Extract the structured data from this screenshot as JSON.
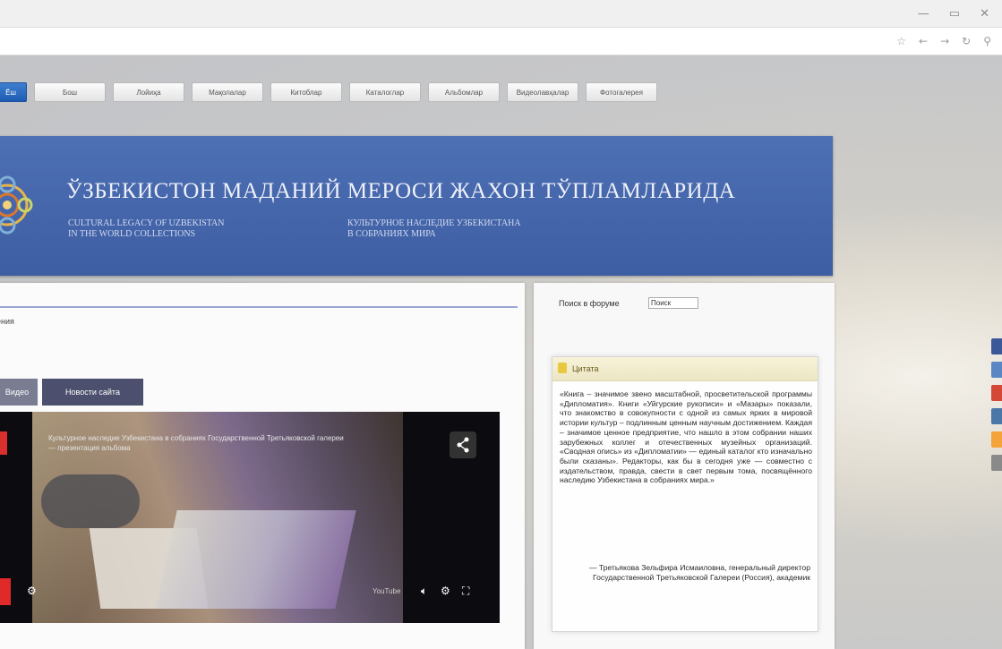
{
  "nav": {
    "items": [
      {
        "label": "Ёш"
      },
      {
        "label": "Бош"
      },
      {
        "label": "Лойиҳа"
      },
      {
        "label": "Мақолалар"
      },
      {
        "label": "Китоблар"
      },
      {
        "label": "Каталоглар"
      },
      {
        "label": "Альбомлар"
      },
      {
        "label": "Видеолавҳалар"
      },
      {
        "label": "Фотогалерея"
      }
    ]
  },
  "banner": {
    "title": "ЎЗБЕКИСТОН МАДАНИЙ МЕРОСИ ЖАХОН ТЎПЛАМЛАРИДА",
    "subtitle_en_1": "CULTURAL LEGACY OF UZBEKISTAN",
    "subtitle_en_2": "IN THE WORLD COLLECTIONS",
    "subtitle_ru_1": "КУЛЬТУРНОЕ НАСЛЕДИЕ УЗБЕКИСТАНА",
    "subtitle_ru_2": "В СОБРАНИЯХ МИРА"
  },
  "content": {
    "breadcrumb": "ения",
    "tabs": [
      {
        "label": "Видео"
      },
      {
        "label": "Новости сайта"
      }
    ]
  },
  "video": {
    "title": "Культурное наследие Узбекистана в собраниях Государственной Третьяковской галереи — презентация альбома",
    "time_label": "YouTube"
  },
  "sidebar": {
    "search_label": "Поиск в форуме",
    "search_value": "Поиск",
    "quote_heading": "Цитата",
    "quote_text": "«Книга – значимое звено масштабной, просветительской программы «Дипломатия». Книги «Уйгурские рукописи» и «Мазары» показали, что знакомство в совокупности с одной из самых ярких в мировой истории культур – подлинным ценным научным достижением. Каждая – значимое ценное предприятие, что нашло в этом собрании наших зарубежных коллег и отечественных музейных организаций. «Сводная опись» из «Дипломатии» — единый каталог кто изначально были сказаны». Редакторы, как бы в сегодня уже — совместно с издательством, правда, свести в свет первым тома, посвящённого наследию Узбекистана в собраниях мира.»",
    "quote_author": "— Третьякова Зельфира Исмаиловна, генеральный директор Государственной Третьяковской Галереи (Россия), академик"
  },
  "colors": {
    "banner": "#4466ab",
    "nav_active": "#2a6bc4",
    "tab_dark": "#4c4f6d"
  }
}
